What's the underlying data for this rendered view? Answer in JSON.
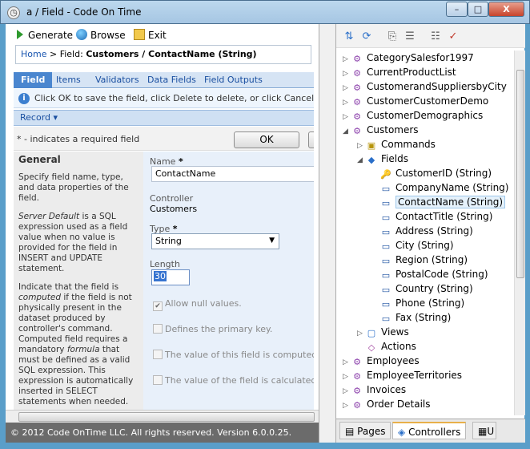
{
  "window": {
    "title": "a / Field - Code On Time",
    "minimize": "–",
    "maximize": "□",
    "close": "X"
  },
  "toolbar": {
    "generate": "Generate",
    "browse": "Browse",
    "exit": "Exit"
  },
  "breadcrumb": {
    "home": "Home",
    "sep": " > ",
    "label": "Field:",
    "current": "Customers / ContactName (String)"
  },
  "tabs": [
    "Field",
    "Items",
    "Validators",
    "Data Fields",
    "Field Outputs"
  ],
  "info_text": "Click OK to save the field, click Delete to delete, or click Cancel to undo changes.",
  "record_menu": "Record",
  "required_note": "* - indicates a required field",
  "ok_label": "OK",
  "description": {
    "heading": "General",
    "p1": "Specify field name, type, and data properties of the field.",
    "p2_em": "Server Default",
    "p2_rest": " is a SQL expression used as a field value when no value is provided for the field in INSERT and UPDATE statement.",
    "p3_a": "Indicate that the field is ",
    "p3_em1": "computed",
    "p3_b": " if the field is not physically present in the dataset produced by controller's command. Computed field requires a mandatory ",
    "p3_em2": "formula",
    "p3_c": " that must be defined as a valid SQL expression. This expression is automatically inserted in SELECT statements when needed."
  },
  "fields": {
    "name_label": "Name",
    "name_value": "ContactName",
    "controller_label": "Controller",
    "controller_value": "Customers",
    "type_label": "Type",
    "type_value": "String",
    "length_label": "Length",
    "length_value": "30",
    "allow_null": "Allow null values.",
    "primary_key": "Defines the primary key.",
    "computed": "The value of this field is computed at run-time.",
    "calculated": "The value of the field is calculated by a business rule."
  },
  "status_text": "© 2012 Code OnTime LLC. All rights reserved. Version 6.0.0.25.",
  "tree": [
    {
      "label": "CategorySalesfor1997",
      "icon": "controller-icon"
    },
    {
      "label": "CurrentProductList",
      "icon": "controller-icon"
    },
    {
      "label": "CustomerandSuppliersbyCity",
      "icon": "controller-icon"
    },
    {
      "label": "CustomerCustomerDemo",
      "icon": "controller-icon"
    },
    {
      "label": "CustomerDemographics",
      "icon": "controller-icon"
    },
    {
      "label": "Customers",
      "icon": "controller-icon"
    },
    {
      "label": "Commands",
      "icon": "commands-icon"
    },
    {
      "label": "Fields",
      "icon": "fields-icon"
    },
    {
      "label": "CustomerID (String)",
      "icon": "key-icon"
    },
    {
      "label": "CompanyName (String)",
      "icon": "field-icon"
    },
    {
      "label": "ContactName (String)",
      "icon": "field-icon"
    },
    {
      "label": "ContactTitle (String)",
      "icon": "field-icon"
    },
    {
      "label": "Address (String)",
      "icon": "field-icon"
    },
    {
      "label": "City (String)",
      "icon": "field-icon"
    },
    {
      "label": "Region (String)",
      "icon": "field-icon"
    },
    {
      "label": "PostalCode (String)",
      "icon": "field-icon"
    },
    {
      "label": "Country (String)",
      "icon": "field-icon"
    },
    {
      "label": "Phone (String)",
      "icon": "field-icon"
    },
    {
      "label": "Fax (String)",
      "icon": "field-icon"
    },
    {
      "label": "Views",
      "icon": "views-icon"
    },
    {
      "label": "Actions",
      "icon": "actions-icon"
    },
    {
      "label": "Employees",
      "icon": "controller-icon"
    },
    {
      "label": "EmployeeTerritories",
      "icon": "controller-icon"
    },
    {
      "label": "Invoices",
      "icon": "controller-icon"
    },
    {
      "label": "Order Details",
      "icon": "controller-icon"
    }
  ],
  "bottom_tabs": [
    "Pages",
    "Controllers",
    "U"
  ]
}
